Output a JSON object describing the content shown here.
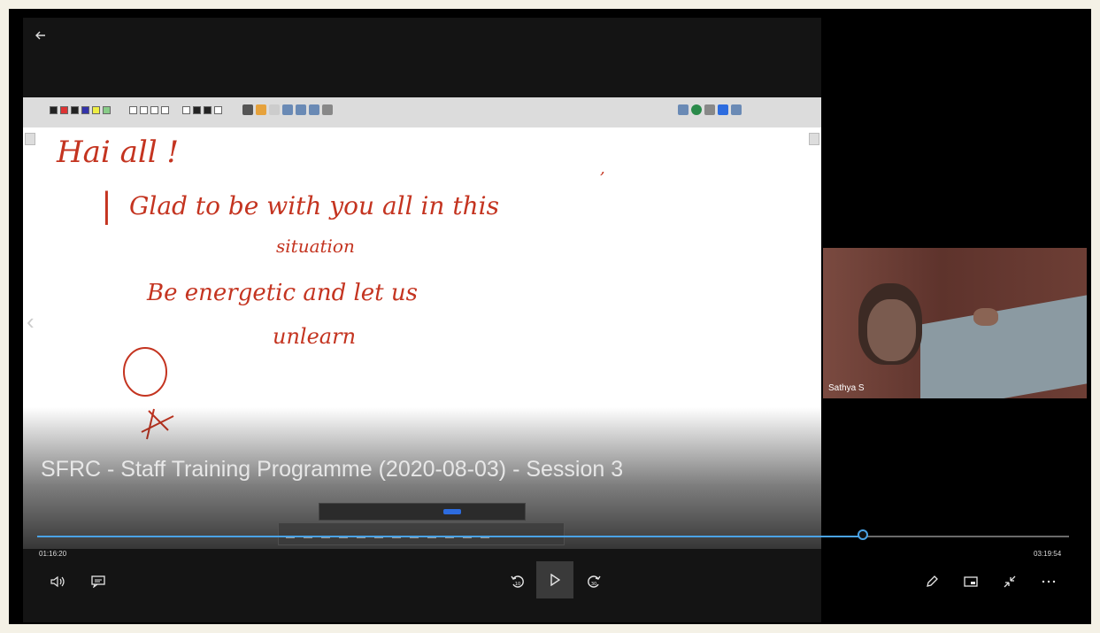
{
  "player": {
    "title": "SFRC - Staff Training Programme (2020-08-03) - Session 3",
    "current_time": "01:16:20",
    "duration": "03:19:54",
    "progress_fraction": 0.8,
    "accent": "#4aa3e6"
  },
  "participant": {
    "name": "Sathya S"
  },
  "whiteboard": {
    "ink_color": "#c43420",
    "lines": [
      "Hai all !",
      "Glad to be with you all in this",
      "situation",
      "Be energetic and let us",
      "unlearn"
    ]
  },
  "icons": {
    "back": "arrow-left-icon",
    "volume": "volume-icon",
    "captions": "captions-icon",
    "skip_back": "skip-back-10-icon",
    "play": "play-icon",
    "skip_forward": "skip-forward-30-icon",
    "edit": "pen-icon",
    "miniplayer": "miniplayer-icon",
    "exit_fullscreen": "exit-fullscreen-icon",
    "more": "more-icon"
  }
}
